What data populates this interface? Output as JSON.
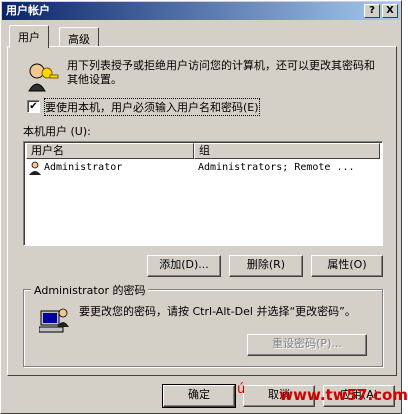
{
  "window": {
    "title": "用户帐户",
    "help_btn": "?",
    "close_btn": "X"
  },
  "tabs": [
    {
      "label": "用户"
    },
    {
      "label": "高级"
    }
  ],
  "intro": {
    "text": "用下列表授予或拒绝用户访问您的计算机，还可以更改其密码和其他设置。"
  },
  "checkbox": {
    "label": "要使用本机，用户必须输入用户名和密码(E)",
    "checked": "✔"
  },
  "list": {
    "section_label": "本机用户 (U):",
    "columns": [
      "用户名",
      "组"
    ],
    "rows": [
      {
        "user": "Administrator",
        "group": "Administrators; Remote ..."
      }
    ]
  },
  "actions": {
    "add": "添加(D)...",
    "delete": "删除(R)",
    "properties": "属性(O)"
  },
  "password_group": {
    "label": "Administrator 的密码",
    "text": "要更改您的密码，请按 Ctrl-Alt-Del 并选择“更改密码”。",
    "reset_btn": "重设密码(P)..."
  },
  "footer": {
    "ok": "确定",
    "cancel": "取消",
    "apply": "应用(A)"
  },
  "watermark": {
    "text": "www.tw57.com",
    "prefix": "ú"
  },
  "colors": {
    "face": "#d4d0c8",
    "title_start": "#0a246a",
    "title_end": "#a6caf0",
    "watermark": "#d40000"
  },
  "icons": [
    "users-key-icon",
    "computer-user-icon",
    "checkmark-icon"
  ]
}
